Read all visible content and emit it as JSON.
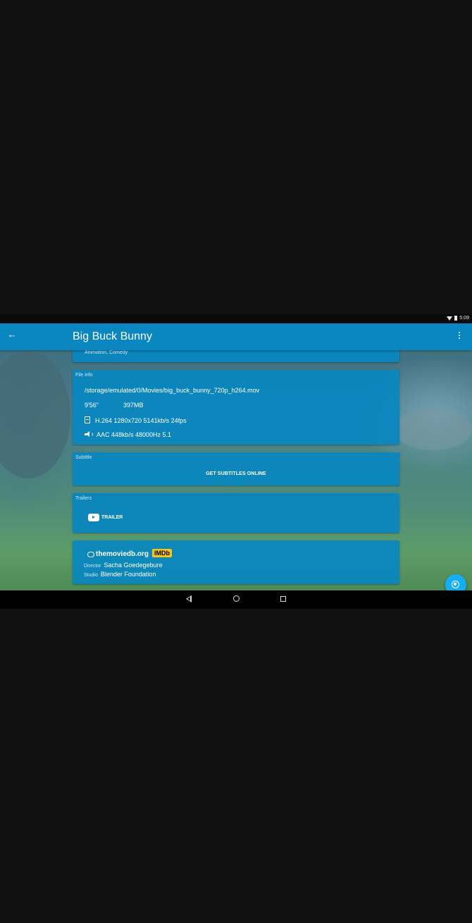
{
  "status_bar": {
    "time": "5:09"
  },
  "app_bar": {
    "title": "Big Buck Bunny"
  },
  "genre_card": {
    "genres": "Animation, Comedy"
  },
  "file_info": {
    "label": "File info",
    "path": "/storage/emulated/0/Movies/big_buck_bunny_720p_h264.mov",
    "duration": "9'56\"",
    "size": "397MB",
    "video": "H.264  1280x720  5141kb/s  24fps",
    "audio": "AAC  448kb/s  48000Hz  5.1"
  },
  "subtitle": {
    "label": "Subtitle",
    "button": "GET SUBTITLES ONLINE"
  },
  "trailers": {
    "label": "Trailers",
    "button": "TRAILER"
  },
  "meta": {
    "tmdb_logo": "themoviedb.org",
    "imdb_logo": "IMDb",
    "director_key": "Director",
    "director": "Sacha Goedegebure",
    "studio_key": "Studio",
    "studio": "Blender Foundation"
  },
  "icons": {
    "back": "arrow-left-icon",
    "overflow": "more-vert-icon",
    "video": "film-icon",
    "audio": "speaker-icon",
    "trailer": "youtube-play-icon",
    "fab": "play-resume-icon"
  },
  "colors": {
    "app_bar": "#0a86c0",
    "card": "#0886c0",
    "fab": "#13aef0",
    "imdb": "#f5c518"
  }
}
